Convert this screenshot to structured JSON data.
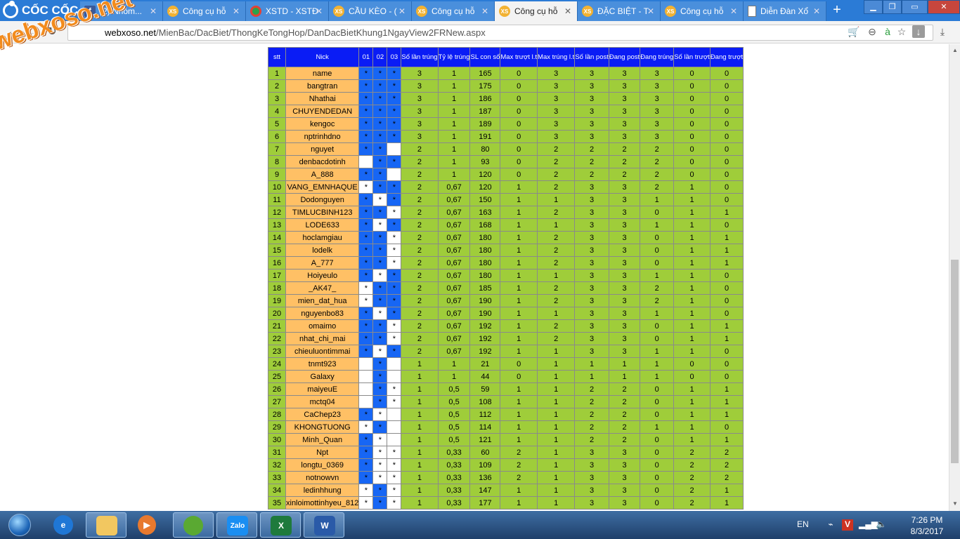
{
  "browser": {
    "brand": "CỐC CỐC",
    "tabs": [
      {
        "label": "(2) Nhóm...",
        "icon": "facebook-icon",
        "active": false
      },
      {
        "label": "Công cụ hỗ",
        "icon": "xs-icon",
        "active": false
      },
      {
        "label": "XSTD - XSTĐ",
        "icon": "chrome-icon",
        "active": false
      },
      {
        "label": "CẦU KÈO - (",
        "icon": "xs-icon",
        "active": false
      },
      {
        "label": "Công cụ hỗ",
        "icon": "xs-icon",
        "active": false
      },
      {
        "label": "Công cụ hỗ",
        "icon": "xs-icon",
        "active": true
      },
      {
        "label": "ĐẶC BIỆT - T",
        "icon": "xs-icon",
        "active": false
      },
      {
        "label": "Công cụ hỗ",
        "icon": "xs-icon",
        "active": false
      },
      {
        "label": "Diễn Đàn Xổ",
        "icon": "document-icon",
        "active": false
      }
    ],
    "url_host": "webxoso.net",
    "url_path": "/MienBac/DacBiet/ThongKeTongHop/DanDacBietKhung1NgayView2FRNew.aspx",
    "watermark": "webxoso.net"
  },
  "table": {
    "headers": [
      "stt",
      "Nick",
      "01",
      "02",
      "03",
      "Số lần trúng",
      "Tỷ lệ trúng",
      "SL con số",
      "Max trượt l.t",
      "Max trúng l.t",
      "Số lần post",
      "Đang post",
      "Đang trúng",
      "Số lần trượt",
      "Đang trượt"
    ],
    "rows": [
      {
        "stt": "1",
        "nick": "name",
        "c": [
          1,
          1,
          1
        ],
        "v": [
          "3",
          "1",
          "165",
          "0",
          "3",
          "3",
          "3",
          "3",
          "0",
          "0"
        ]
      },
      {
        "stt": "2",
        "nick": "bangtran",
        "c": [
          1,
          1,
          1
        ],
        "v": [
          "3",
          "1",
          "175",
          "0",
          "3",
          "3",
          "3",
          "3",
          "0",
          "0"
        ]
      },
      {
        "stt": "3",
        "nick": "Nhathai",
        "c": [
          1,
          1,
          1
        ],
        "v": [
          "3",
          "1",
          "186",
          "0",
          "3",
          "3",
          "3",
          "3",
          "0",
          "0"
        ]
      },
      {
        "stt": "4",
        "nick": "CHUYENDEDAN",
        "c": [
          1,
          1,
          1
        ],
        "v": [
          "3",
          "1",
          "187",
          "0",
          "3",
          "3",
          "3",
          "3",
          "0",
          "0"
        ]
      },
      {
        "stt": "5",
        "nick": "kengoc",
        "c": [
          1,
          1,
          1
        ],
        "v": [
          "3",
          "1",
          "189",
          "0",
          "3",
          "3",
          "3",
          "3",
          "0",
          "0"
        ]
      },
      {
        "stt": "6",
        "nick": "nptrinhdno",
        "c": [
          1,
          1,
          1
        ],
        "v": [
          "3",
          "1",
          "191",
          "0",
          "3",
          "3",
          "3",
          "3",
          "0",
          "0"
        ]
      },
      {
        "stt": "7",
        "nick": "nguyet",
        "c": [
          1,
          1,
          0
        ],
        "v": [
          "2",
          "1",
          "80",
          "0",
          "2",
          "2",
          "2",
          "2",
          "0",
          "0"
        ]
      },
      {
        "stt": "8",
        "nick": "denbacdotinh",
        "c": [
          0,
          1,
          1
        ],
        "v": [
          "2",
          "1",
          "93",
          "0",
          "2",
          "2",
          "2",
          "2",
          "0",
          "0"
        ]
      },
      {
        "stt": "9",
        "nick": "A_888",
        "c": [
          1,
          1,
          0
        ],
        "v": [
          "2",
          "1",
          "120",
          "0",
          "2",
          "2",
          "2",
          "2",
          "0",
          "0"
        ]
      },
      {
        "stt": "10",
        "nick": "VANG_EMNHAQUE",
        "c": [
          2,
          1,
          1
        ],
        "v": [
          "2",
          "0,67",
          "120",
          "1",
          "2",
          "3",
          "3",
          "2",
          "1",
          "0"
        ]
      },
      {
        "stt": "11",
        "nick": "Dodonguyen",
        "c": [
          1,
          2,
          1
        ],
        "v": [
          "2",
          "0,67",
          "150",
          "1",
          "1",
          "3",
          "3",
          "1",
          "1",
          "0"
        ]
      },
      {
        "stt": "12",
        "nick": "TIMLUCBINH123",
        "c": [
          1,
          1,
          2
        ],
        "v": [
          "2",
          "0,67",
          "163",
          "1",
          "2",
          "3",
          "3",
          "0",
          "1",
          "1"
        ]
      },
      {
        "stt": "13",
        "nick": "LODE633",
        "c": [
          1,
          2,
          1
        ],
        "v": [
          "2",
          "0,67",
          "168",
          "1",
          "1",
          "3",
          "3",
          "1",
          "1",
          "0"
        ]
      },
      {
        "stt": "14",
        "nick": "hoclamgiau",
        "c": [
          1,
          1,
          2
        ],
        "v": [
          "2",
          "0,67",
          "180",
          "1",
          "2",
          "3",
          "3",
          "0",
          "1",
          "1"
        ]
      },
      {
        "stt": "15",
        "nick": "lodelk",
        "c": [
          1,
          1,
          2
        ],
        "v": [
          "2",
          "0,67",
          "180",
          "1",
          "2",
          "3",
          "3",
          "0",
          "1",
          "1"
        ]
      },
      {
        "stt": "16",
        "nick": "A_777",
        "c": [
          1,
          1,
          2
        ],
        "v": [
          "2",
          "0,67",
          "180",
          "1",
          "2",
          "3",
          "3",
          "0",
          "1",
          "1"
        ]
      },
      {
        "stt": "17",
        "nick": "Hoiyeulo",
        "c": [
          1,
          2,
          1
        ],
        "v": [
          "2",
          "0,67",
          "180",
          "1",
          "1",
          "3",
          "3",
          "1",
          "1",
          "0"
        ]
      },
      {
        "stt": "18",
        "nick": "_AK47_",
        "c": [
          2,
          1,
          1
        ],
        "v": [
          "2",
          "0,67",
          "185",
          "1",
          "2",
          "3",
          "3",
          "2",
          "1",
          "0"
        ]
      },
      {
        "stt": "19",
        "nick": "mien_dat_hua",
        "c": [
          2,
          1,
          1
        ],
        "v": [
          "2",
          "0,67",
          "190",
          "1",
          "2",
          "3",
          "3",
          "2",
          "1",
          "0"
        ]
      },
      {
        "stt": "20",
        "nick": "nguyenbo83",
        "c": [
          1,
          2,
          1
        ],
        "v": [
          "2",
          "0,67",
          "190",
          "1",
          "1",
          "3",
          "3",
          "1",
          "1",
          "0"
        ]
      },
      {
        "stt": "21",
        "nick": "omaimo",
        "c": [
          1,
          1,
          2
        ],
        "v": [
          "2",
          "0,67",
          "192",
          "1",
          "2",
          "3",
          "3",
          "0",
          "1",
          "1"
        ]
      },
      {
        "stt": "22",
        "nick": "nhat_chi_mai",
        "c": [
          1,
          1,
          2
        ],
        "v": [
          "2",
          "0,67",
          "192",
          "1",
          "2",
          "3",
          "3",
          "0",
          "1",
          "1"
        ]
      },
      {
        "stt": "23",
        "nick": "chieuluontimmai",
        "c": [
          1,
          2,
          1
        ],
        "v": [
          "2",
          "0,67",
          "192",
          "1",
          "1",
          "3",
          "3",
          "1",
          "1",
          "0"
        ]
      },
      {
        "stt": "24",
        "nick": "tnmt923",
        "c": [
          0,
          1,
          0
        ],
        "v": [
          "1",
          "1",
          "21",
          "0",
          "1",
          "1",
          "1",
          "1",
          "0",
          "0"
        ]
      },
      {
        "stt": "25",
        "nick": "Galaxy",
        "c": [
          0,
          1,
          0
        ],
        "v": [
          "1",
          "1",
          "44",
          "0",
          "1",
          "1",
          "1",
          "1",
          "0",
          "0"
        ]
      },
      {
        "stt": "26",
        "nick": "maiyeuE",
        "c": [
          0,
          1,
          2
        ],
        "v": [
          "1",
          "0,5",
          "59",
          "1",
          "1",
          "2",
          "2",
          "0",
          "1",
          "1"
        ]
      },
      {
        "stt": "27",
        "nick": "mctq04",
        "c": [
          0,
          1,
          2
        ],
        "v": [
          "1",
          "0,5",
          "108",
          "1",
          "1",
          "2",
          "2",
          "0",
          "1",
          "1"
        ]
      },
      {
        "stt": "28",
        "nick": "CaChep23",
        "c": [
          1,
          2,
          0
        ],
        "v": [
          "1",
          "0,5",
          "112",
          "1",
          "1",
          "2",
          "2",
          "0",
          "1",
          "1"
        ]
      },
      {
        "stt": "29",
        "nick": "KHONGTUONG",
        "c": [
          2,
          1,
          0
        ],
        "v": [
          "1",
          "0,5",
          "114",
          "1",
          "1",
          "2",
          "2",
          "1",
          "1",
          "0"
        ]
      },
      {
        "stt": "30",
        "nick": "Minh_Quan",
        "c": [
          1,
          2,
          0
        ],
        "v": [
          "1",
          "0,5",
          "121",
          "1",
          "1",
          "2",
          "2",
          "0",
          "1",
          "1"
        ]
      },
      {
        "stt": "31",
        "nick": "Npt",
        "c": [
          1,
          2,
          2
        ],
        "v": [
          "1",
          "0,33",
          "60",
          "2",
          "1",
          "3",
          "3",
          "0",
          "2",
          "2"
        ]
      },
      {
        "stt": "32",
        "nick": "longtu_0369",
        "c": [
          1,
          2,
          2
        ],
        "v": [
          "1",
          "0,33",
          "109",
          "2",
          "1",
          "3",
          "3",
          "0",
          "2",
          "2"
        ]
      },
      {
        "stt": "33",
        "nick": "notnowvn",
        "c": [
          1,
          2,
          2
        ],
        "v": [
          "1",
          "0,33",
          "136",
          "2",
          "1",
          "3",
          "3",
          "0",
          "2",
          "2"
        ]
      },
      {
        "stt": "34",
        "nick": "ledinhhung",
        "c": [
          2,
          1,
          2
        ],
        "v": [
          "1",
          "0,33",
          "147",
          "1",
          "1",
          "3",
          "3",
          "0",
          "2",
          "1"
        ]
      },
      {
        "stt": "35",
        "nick": "xinloimottinhyeu_812",
        "c": [
          2,
          1,
          2
        ],
        "v": [
          "1",
          "0,33",
          "177",
          "1",
          "1",
          "3",
          "3",
          "0",
          "2",
          "1"
        ]
      }
    ]
  },
  "taskbar": {
    "lang": "EN",
    "time": "7:26 PM",
    "date": "8/3/2017",
    "apps": [
      "explorer-icon",
      "file-explorer-icon",
      "media-player-icon",
      "coccoc-icon",
      "zalo-icon",
      "excel-icon",
      "word-icon"
    ],
    "zalo_label": "Zalo",
    "excel_label": "X",
    "word_label": "W"
  },
  "colors": {
    "header_bg": "#0a1cf5",
    "green": "#9fcd3a",
    "orange": "#ffc065",
    "blue_cell": "#1766f4"
  }
}
